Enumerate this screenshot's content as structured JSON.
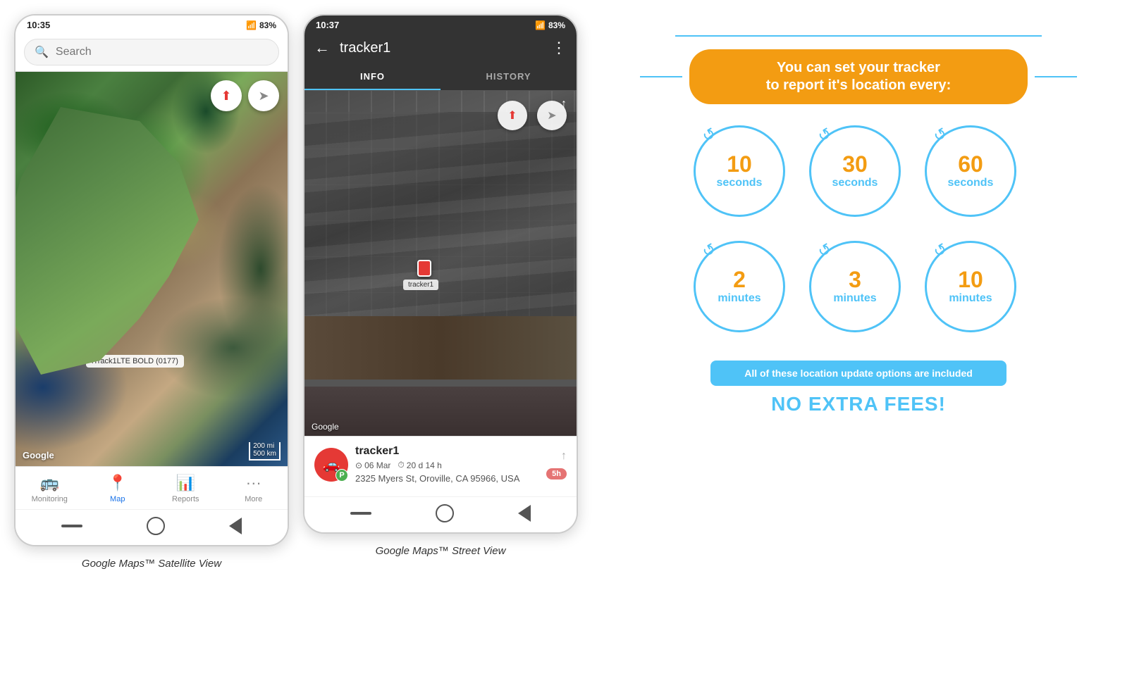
{
  "phone1": {
    "status_bar": {
      "time": "10:35",
      "battery": "83%"
    },
    "search": {
      "placeholder": "Search"
    },
    "map": {
      "tracker_label": "iTrack1LTE BOLD (0177)",
      "google_logo": "Google",
      "scale": "200 mi\n500 km"
    },
    "nav": {
      "items": [
        {
          "label": "Monitoring",
          "icon": "🚌",
          "active": false
        },
        {
          "label": "Map",
          "icon": "📍",
          "active": true
        },
        {
          "label": "Reports",
          "icon": "📊",
          "active": false
        },
        {
          "label": "More",
          "icon": "•••",
          "active": false
        }
      ]
    },
    "caption": "Google Maps™ Satellite View"
  },
  "phone2": {
    "status_bar": {
      "time": "10:37",
      "battery": "83%"
    },
    "header": {
      "title": "tracker1",
      "back": "←",
      "more": "⋮"
    },
    "tabs": [
      {
        "label": "INFO",
        "active": true
      },
      {
        "label": "HISTORY",
        "active": false
      }
    ],
    "map": {
      "car_label": "tracker1",
      "google_logo": "Google"
    },
    "info_card": {
      "name": "tracker1",
      "date": "06 Mar",
      "duration": "20 d 14 h",
      "address": "2325 Myers St, Oroville, CA 95966, USA",
      "time_ago": "5h"
    },
    "caption": "Google Maps™ Street View"
  },
  "promo": {
    "banner_text": "You can set your tracker\nto report it's location every:",
    "circles": [
      {
        "number": "10",
        "unit": "seconds"
      },
      {
        "number": "30",
        "unit": "seconds"
      },
      {
        "number": "60",
        "unit": "seconds"
      },
      {
        "number": "2",
        "unit": "minutes"
      },
      {
        "number": "3",
        "unit": "minutes"
      },
      {
        "number": "10",
        "unit": "minutes"
      }
    ],
    "included_text": "All of these location update options are included",
    "no_fees_text": "NO EXTRA FEES!"
  }
}
